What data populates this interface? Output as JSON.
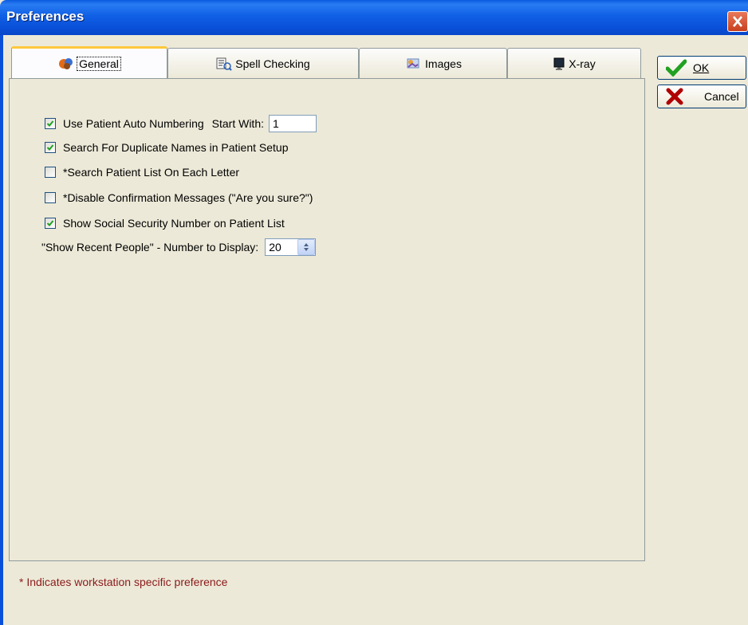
{
  "window": {
    "title": "Preferences"
  },
  "tabs": [
    {
      "label": "General",
      "icon": "general-icon",
      "active": true
    },
    {
      "label": "Spell Checking",
      "icon": "spell-check-icon",
      "active": false
    },
    {
      "label": "Images",
      "icon": "images-icon",
      "active": false
    },
    {
      "label": "X-ray",
      "icon": "xray-monitor-icon",
      "active": false
    }
  ],
  "general": {
    "auto_numbering": {
      "label": "Use Patient Auto Numbering",
      "checked": true,
      "start_label": "Start With:",
      "start_value": "1"
    },
    "duplicate_names": {
      "label": "Search For Duplicate Names in Patient Setup",
      "checked": true
    },
    "search_each_letter": {
      "label": "*Search Patient List On Each Letter",
      "checked": false
    },
    "disable_confirm": {
      "label": "*Disable Confirmation Messages (\"Are you sure?\")",
      "checked": false
    },
    "show_ssn": {
      "label": "Show Social Security Number on Patient List",
      "checked": true
    },
    "recent_people": {
      "label": "\"Show Recent People\" - Number to Display:",
      "value": "20"
    }
  },
  "buttons": {
    "ok": "OK",
    "cancel": "Cancel"
  },
  "footnote": "* Indicates workstation specific preference",
  "colors": {
    "titlebar": "#0a4fd8",
    "active_tab_accent": "#ffc83c",
    "footnote": "#8b1a1a",
    "check": "#21a121",
    "cancel_x": "#b00000"
  }
}
